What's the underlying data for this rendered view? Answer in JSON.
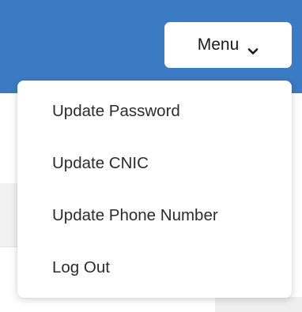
{
  "header": {
    "accent_color": "#3b7bc4",
    "menu_button": {
      "label": "Menu",
      "icon": "chevron-down-icon"
    }
  },
  "dropdown": {
    "items": [
      {
        "label": "Update Password"
      },
      {
        "label": "Update CNIC"
      },
      {
        "label": "Update Phone Number"
      },
      {
        "label": "Log Out"
      }
    ]
  }
}
